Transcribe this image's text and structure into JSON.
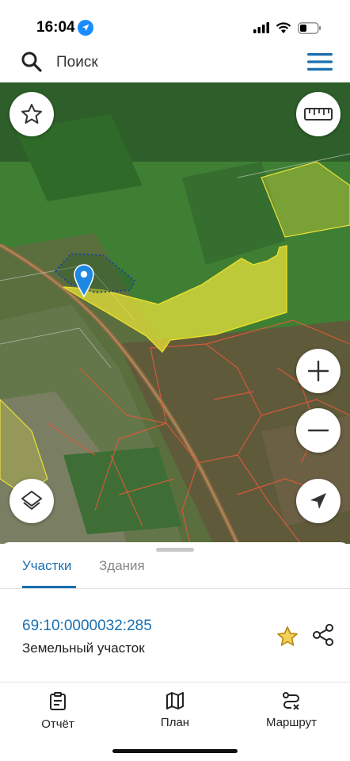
{
  "status": {
    "time": "16:04"
  },
  "search": {
    "placeholder": "Поиск"
  },
  "sheet": {
    "tabs": [
      {
        "label": "Участки"
      },
      {
        "label": "Здания"
      }
    ],
    "parcel": {
      "cadastral_number": "69:10:0000032:285",
      "type": "Земельный участок"
    }
  },
  "tabbar": {
    "items": [
      {
        "label": "Отчёт",
        "icon": "report-icon"
      },
      {
        "label": "План",
        "icon": "map-plan-icon"
      },
      {
        "label": "Маршрут",
        "icon": "route-icon"
      }
    ]
  },
  "colors": {
    "accent": "#1a6fb0",
    "parcel_highlight": "#e8e23a",
    "parcel_border": "#e05a3a",
    "favorite_star": "#d4a017"
  }
}
